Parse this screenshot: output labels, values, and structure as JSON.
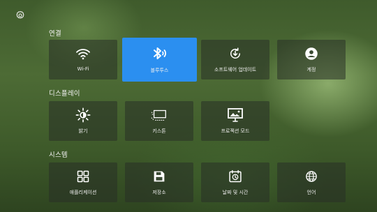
{
  "sections": [
    {
      "title": "연결",
      "items": [
        {
          "label": "Wi-Fi",
          "icon": "wifi-icon"
        },
        {
          "label": "블루투스",
          "icon": "bluetooth-audio-icon",
          "selected": true
        },
        {
          "label": "소프트웨어 업데이트",
          "icon": "system-update-icon"
        },
        {
          "label": "계정",
          "icon": "account-icon"
        }
      ]
    },
    {
      "title": "디스플레이",
      "items": [
        {
          "label": "밝기",
          "icon": "brightness-icon"
        },
        {
          "label": "키스톤",
          "icon": "keystone-icon"
        },
        {
          "label": "프로젝션 모드",
          "icon": "projection-mode-icon"
        }
      ]
    },
    {
      "title": "시스템",
      "items": [
        {
          "label": "애플리케이션",
          "icon": "apps-grid-icon"
        },
        {
          "label": "저장소",
          "icon": "save-icon"
        },
        {
          "label": "날짜 및 시간",
          "icon": "date-time-icon"
        },
        {
          "label": "언어",
          "icon": "globe-icon"
        }
      ]
    }
  ],
  "colors": {
    "selected": "#2b8ff0",
    "tile": "rgba(40,48,38,0.55)",
    "text": "#f0f0f0"
  }
}
